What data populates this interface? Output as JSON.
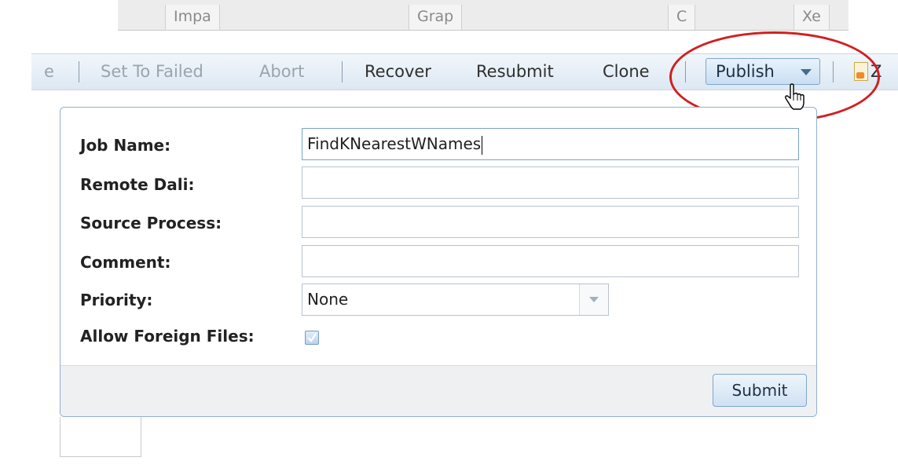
{
  "tabs": [
    {
      "label": "Impa"
    },
    {
      "label": "Grap"
    },
    {
      "label": "C"
    },
    {
      "label": "Xe"
    }
  ],
  "toolbar": {
    "items": [
      {
        "label": "e",
        "state": "disabled"
      },
      {
        "label": "Set To Failed",
        "state": "disabled"
      },
      {
        "label": "Abort",
        "state": "disabled"
      },
      {
        "label": "Recover",
        "state": "enabled"
      },
      {
        "label": "Resubmit",
        "state": "enabled"
      },
      {
        "label": "Clone",
        "state": "enabled"
      }
    ],
    "publish_label": "Publish",
    "trailing_label": "Z"
  },
  "form": {
    "fields": [
      {
        "label": "Job Name:",
        "value": "FindKNearestWNames"
      },
      {
        "label": "Remote Dali:",
        "value": ""
      },
      {
        "label": "Source Process:",
        "value": ""
      },
      {
        "label": "Comment:",
        "value": ""
      }
    ],
    "priority": {
      "label": "Priority:",
      "value": "None"
    },
    "allow_foreign": {
      "label": "Allow Foreign Files:",
      "checked": true
    },
    "submit_label": "Submit"
  },
  "colors": {
    "highlight_ellipse": "#d11f1f",
    "accent_border": "#7ea6cc"
  }
}
